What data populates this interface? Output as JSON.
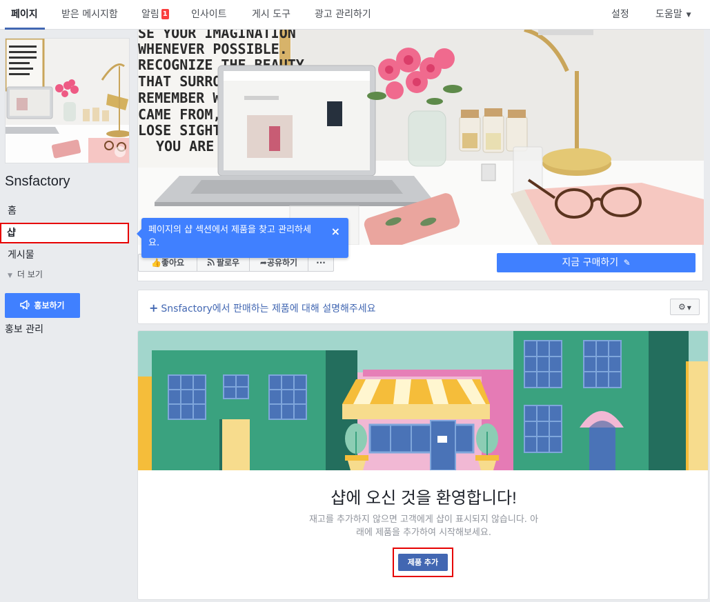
{
  "topnav": {
    "tabs": [
      {
        "label": "페이지"
      },
      {
        "label": "받은 메시지함"
      },
      {
        "label": "알림",
        "badge": "1"
      },
      {
        "label": "인사이트"
      },
      {
        "label": "게시 도구"
      },
      {
        "label": "광고 관리하기"
      }
    ],
    "settings": "설정",
    "help": "도움말"
  },
  "sidebar": {
    "page_name": "Snsfactory",
    "items": [
      {
        "label": "홈"
      },
      {
        "label": "샵"
      },
      {
        "label": "게시물"
      }
    ],
    "more": "더 보기",
    "promote_button": "홍보하기",
    "promote_manage": "홍보 관리"
  },
  "cover": {
    "poster_lines": [
      "SE YOUR IMAGINATION",
      "WHENEVER POSSIBLE.",
      "RECOGNIZE THE BEAUTY",
      "THAT SURROUNDS",
      "REMEMBER WHE",
      "CAME FROM, BUT",
      "LOSE SIGHT OF",
      "YOU ARE GO"
    ],
    "actions": {
      "like": "좋아요",
      "follow": "팔로우",
      "share": "공유하기",
      "more": "···"
    },
    "buy_now": "지금 구매하기"
  },
  "tooltip": {
    "text": "페이지의 샵 섹션에서 제품을 찾고 관리하세요.",
    "close": "×"
  },
  "describe": {
    "link": "Snsfactory에서 판매하는 제품에 대해 설명해주세요"
  },
  "shop": {
    "title": "샵에 오신 것을 환영합니다!",
    "description": "재고를 추가하지 않으면 고객에게 샵이 표시되지 않습니다. 아래에 제품을 추가하여 시작해보세요.",
    "add_button": "제품 추가"
  },
  "colors": {
    "fb_blue": "#4267b2",
    "button_blue": "#4080ff",
    "highlight_red": "#e60000",
    "badge_red": "#fa3e3e",
    "background": "#e9ebee"
  }
}
